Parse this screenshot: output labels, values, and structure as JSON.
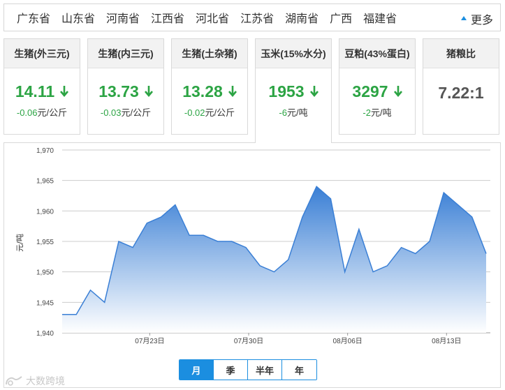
{
  "provinces": [
    "广东省",
    "山东省",
    "河南省",
    "江西省",
    "河北省",
    "江苏省",
    "湖南省",
    "广西",
    "福建省"
  ],
  "more_label": "更多",
  "cards": [
    {
      "title": "生猪(外三元)",
      "value": "14.11",
      "change": "-0.06",
      "unit": "元/公斤",
      "trend": "down"
    },
    {
      "title": "生猪(内三元)",
      "value": "13.73",
      "change": "-0.03",
      "unit": "元/公斤",
      "trend": "down"
    },
    {
      "title": "生猪(土杂猪)",
      "value": "13.28",
      "change": "-0.02",
      "unit": "元/公斤",
      "trend": "down"
    },
    {
      "title": "玉米(15%水分)",
      "value": "1953",
      "change": "-6",
      "unit": "元/吨",
      "trend": "down"
    },
    {
      "title": "豆粕(43%蛋白)",
      "value": "3297",
      "change": "-2",
      "unit": "元/吨",
      "trend": "down"
    },
    {
      "title": "猪粮比",
      "value": "7.22:1",
      "change": "",
      "unit": "",
      "trend": "none"
    }
  ],
  "active_card_index": 3,
  "colors": {
    "accent": "#1b8ee0",
    "down": "#2ca444",
    "area_top": "#3a7fd5",
    "area_bottom": "#ffffff"
  },
  "range_tabs": [
    "月",
    "季",
    "半年",
    "年"
  ],
  "active_range_index": 0,
  "watermark_text": "大数跨境",
  "chart_data": {
    "type": "area",
    "title": "",
    "xlabel": "",
    "ylabel": "元/吨",
    "ylim": [
      1940,
      1970
    ],
    "yticks": [
      1940,
      1945,
      1950,
      1955,
      1960,
      1965,
      1970
    ],
    "ytick_labels": [
      "1,940",
      "1,945",
      "1,950",
      "1,955",
      "1,960",
      "1,965",
      "1,970"
    ],
    "x": [
      "07月16日",
      "07月17日",
      "07月18日",
      "07月19日",
      "07月20日",
      "07月21日",
      "07月22日",
      "07月23日",
      "07月24日",
      "07月25日",
      "07月26日",
      "07月27日",
      "07月28日",
      "07月29日",
      "07月30日",
      "07月31日",
      "08月01日",
      "08月02日",
      "08月03日",
      "08月04日",
      "08月05日",
      "08月06日",
      "08月07日",
      "08月08日",
      "08月09日",
      "08月10日",
      "08月11日",
      "08月12日",
      "08月13日",
      "08月14日",
      "08月15日",
      "08月16日"
    ],
    "values": [
      1943,
      1943,
      1947,
      1945,
      1955,
      1954,
      1958,
      1959,
      1961,
      1956,
      1956,
      1955,
      1955,
      1954,
      1951,
      1950,
      1952,
      1959,
      1964,
      1962,
      1950,
      1957,
      1950,
      1951,
      1954,
      1953,
      1955,
      1963,
      1961,
      1959,
      1953
    ],
    "xtick_labels": [
      "07月23日",
      "07月30日",
      "08月06日",
      "08月13日"
    ],
    "xtick_indices": [
      6,
      13,
      20,
      27
    ],
    "grid": true,
    "legend": "none"
  }
}
